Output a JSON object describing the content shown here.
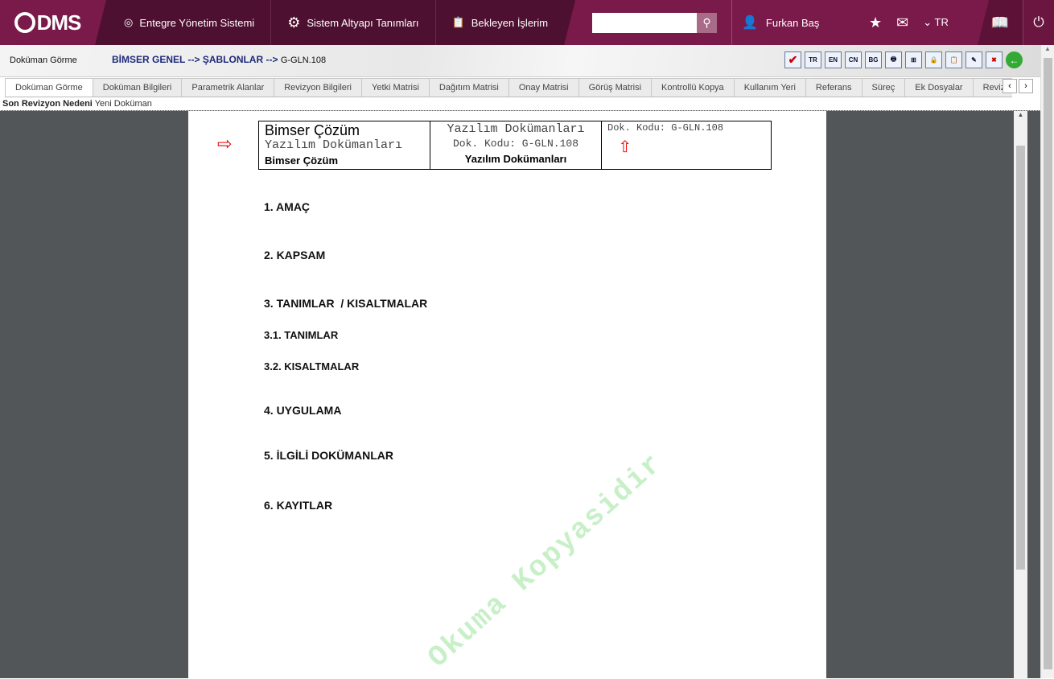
{
  "topbar": {
    "logo": "DMS",
    "nav": [
      "Entegre Yönetim Sistemi",
      "Sistem Altyapı Tanımları",
      "Bekleyen İşlerim"
    ],
    "search_placeholder": "",
    "user": "Furkan Baş",
    "language": "TR"
  },
  "subheader": {
    "title": "Doküman Görme",
    "breadcrumb": [
      "BİMSER GENEL",
      "-->",
      "ŞABLONLAR",
      "-->"
    ],
    "doc_code": "G-GLN.108",
    "tools": [
      "TR",
      "EN",
      "CN",
      "BG"
    ]
  },
  "tabs": [
    "Doküman Görme",
    "Doküman Bilgileri",
    "Parametrik Alanlar",
    "Revizyon Bilgileri",
    "Yetki Matrisi",
    "Dağıtım Matrisi",
    "Onay Matrisi",
    "Görüş Matrisi",
    "Kontrollü Kopya",
    "Kullanım Yeri",
    "Referans",
    "Süreç",
    "Ek Dosyalar",
    "Revizyon"
  ],
  "revision": {
    "label": "Son Revizyon Nedeni",
    "value": "Yeni Doküman"
  },
  "document": {
    "header": {
      "c1_title": "Bimser Çözüm",
      "c1_sub": "Yazılım Dokümanları",
      "c1_bold": "Bimser Çözüm",
      "c2_title": "Yazılım Dokümanları",
      "c2_code": "Dok. Kodu: G-GLN.108",
      "c2_bold": "Yazılım Dokümanları",
      "c3_code": "Dok. Kodu: G-GLN.108"
    },
    "headings": [
      "1. AMAÇ",
      "2. KAPSAM",
      "3. TANIMLAR  / KISALTMALAR",
      "3.1. TANIMLAR",
      "3.2. KISALTMALAR",
      "4. UYGULAMA",
      "5. İLGİLİ DOKÜMANLAR",
      "6. KAYITLAR"
    ],
    "watermark": "Okuma Kopyasidir"
  }
}
